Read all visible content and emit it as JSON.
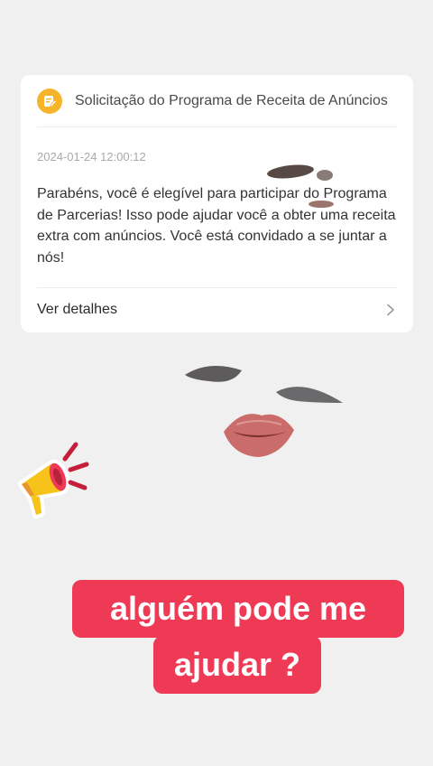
{
  "notification": {
    "title": "Solicitação do Programa de Receita de Anúncios",
    "timestamp": "2024-01-24 12:00:12",
    "message": "Parabéns, você é elegível para participar do Programa de Parcerias! Isso pode ajudar você a obter uma receita extra com anúncios. Você está convidado a se juntar a nós!",
    "details_label": "Ver detalhes",
    "icon": "document-edit-icon",
    "icon_color": "#f6b42a"
  },
  "caption": {
    "line1": "alguém pode me",
    "line2": "ajudar ?",
    "background_color": "#ef3a56"
  },
  "decorations": {
    "megaphone": "megaphone-icon",
    "face": "face-overlay"
  }
}
